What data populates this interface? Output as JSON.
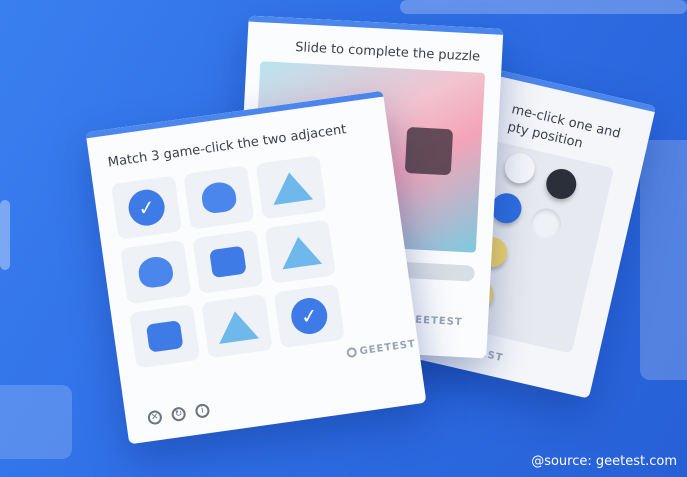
{
  "cards": {
    "match": {
      "title": "Match 3 game-click the two adjacent",
      "brand": "GEETEST",
      "tiles": [
        "check-icon",
        "robot-duck-icon",
        "pyramid-icon",
        "robot-duck-icon",
        "robot-head-icon",
        "pyramid-icon",
        "robot-head-icon",
        "pyramid-icon",
        "check-icon"
      ],
      "footer_icons": [
        "close-icon",
        "refresh-icon",
        "info-icon"
      ]
    },
    "slide": {
      "title": "Slide to complete the puzzle",
      "brand": "GEETEST"
    },
    "chess": {
      "title_line1": "me-click one and",
      "title_line2": "pty position",
      "brand": "GEETEST"
    }
  },
  "source": "@source: geetest.com",
  "colors": {
    "background": "#2f6fe6",
    "accent": "#4a86ec",
    "blue_piece": "#2f6fe0",
    "yellow_piece": "#f0d36a",
    "black_piece": "#2a2f3a",
    "white_piece": "#eef1f6"
  }
}
